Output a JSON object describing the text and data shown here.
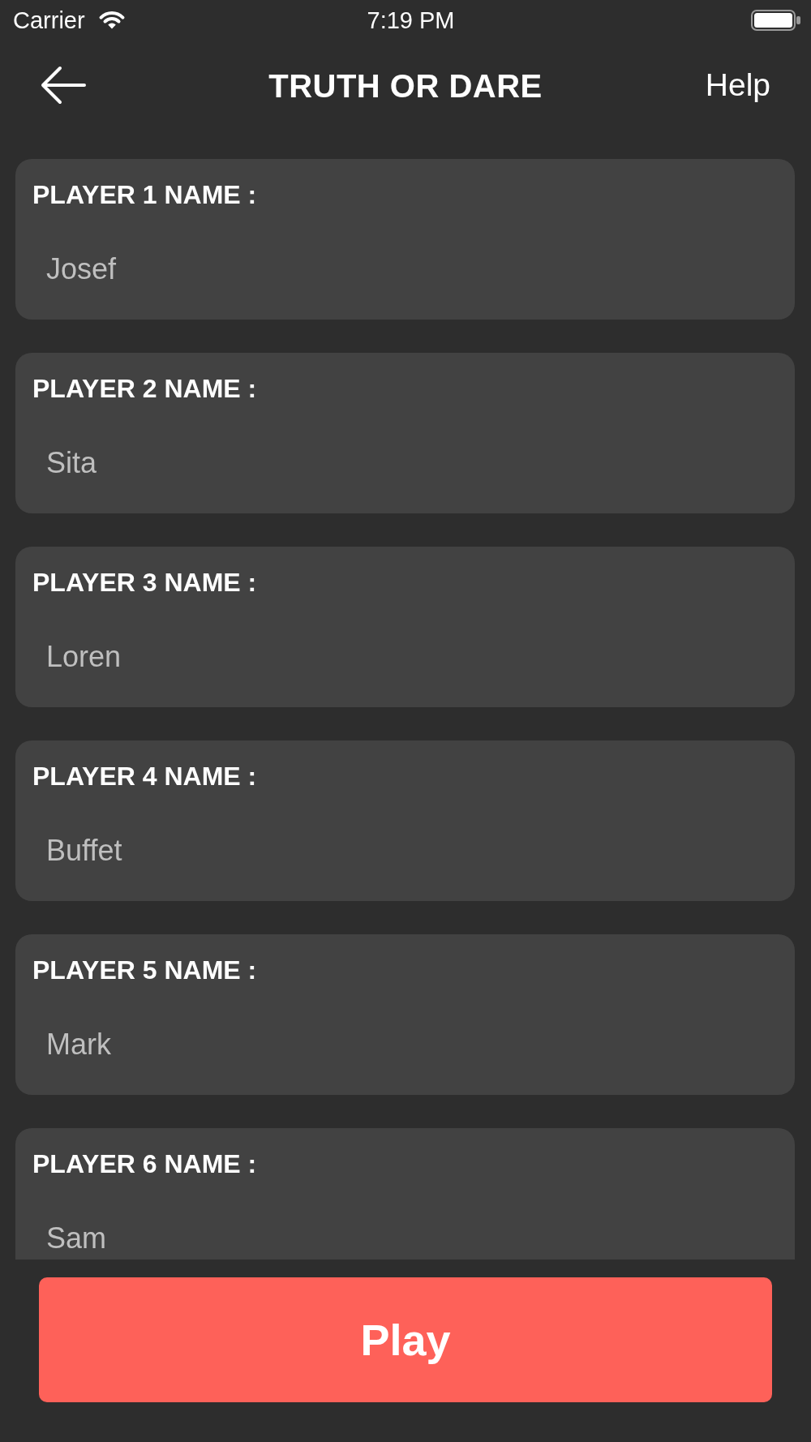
{
  "status_bar": {
    "carrier": "Carrier",
    "time": "7:19 PM"
  },
  "header": {
    "title": "TRUTH OR DARE",
    "help": "Help"
  },
  "players": [
    {
      "label": "PLAYER 1 NAME :",
      "value": "Josef"
    },
    {
      "label": "PLAYER 2 NAME :",
      "value": "Sita"
    },
    {
      "label": "PLAYER 3 NAME :",
      "value": "Loren"
    },
    {
      "label": "PLAYER 4 NAME :",
      "value": "Buffet"
    },
    {
      "label": "PLAYER 5 NAME :",
      "value": "Mark"
    },
    {
      "label": "PLAYER 6 NAME :",
      "value": "Sam"
    }
  ],
  "play_button": {
    "label": "Play"
  }
}
